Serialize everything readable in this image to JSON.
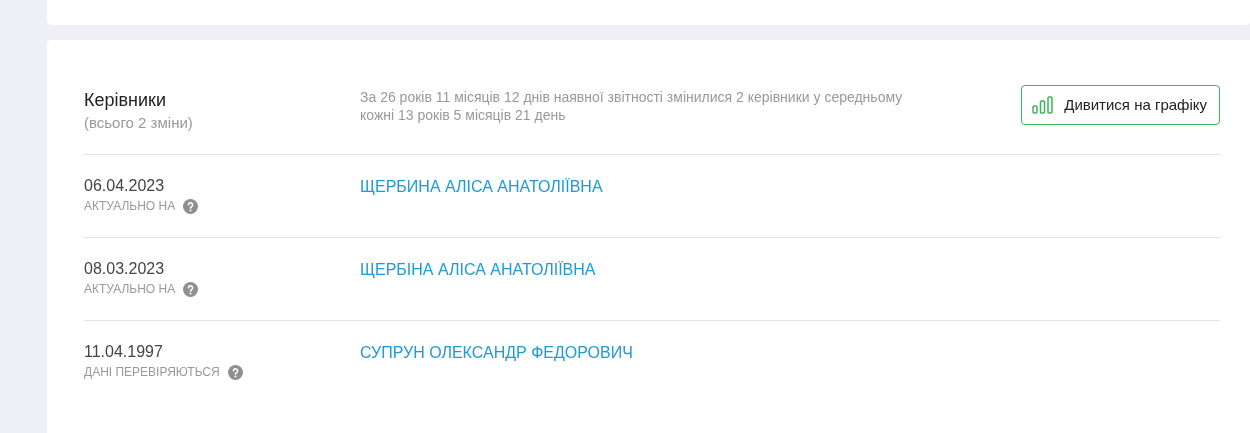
{
  "section": {
    "title": "Керівники",
    "subtitle": "(всього 2 зміни)",
    "summary": "За 26 років 11 місяців 12 днів наявної звітності змінилися 2 керівники у середньому кожні 13 років 5 місяців 21 день",
    "chart_button": "Дивитися на графіку"
  },
  "rows": [
    {
      "date": "06.04.2023",
      "note": "АКТУАЛЬНО НА",
      "name": "ЩЕРБИНА АЛІСА АНАТОЛІЇВНА"
    },
    {
      "date": "08.03.2023",
      "note": "АКТУАЛЬНО НА",
      "name": "ЩЕРБІНА АЛІСА АНАТОЛІЇВНА"
    },
    {
      "date": "11.04.1997",
      "note": "ДАНІ ПЕРЕВІРЯЮТЬСЯ",
      "name": "СУПРУН ОЛЕКСАНДР ФЕДОРОВИЧ"
    }
  ]
}
